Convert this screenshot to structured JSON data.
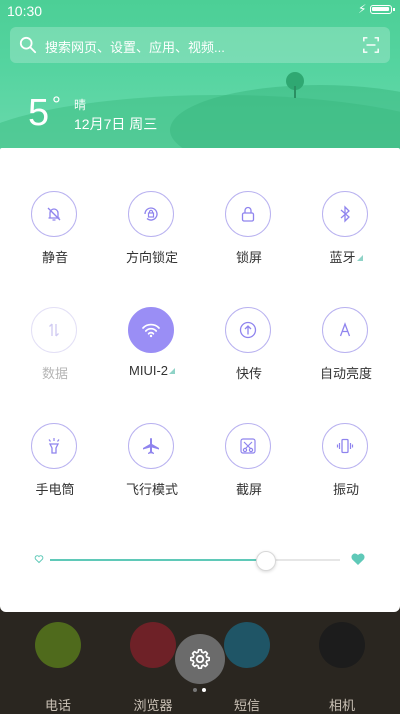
{
  "status": {
    "time": "10:30"
  },
  "search": {
    "placeholder": "搜索网页、设置、应用、视频..."
  },
  "weather": {
    "temp": "5",
    "degree": "°",
    "condition": "晴",
    "date": "12月7日 周三"
  },
  "tiles": [
    {
      "label": "静音",
      "icon": "mute-icon",
      "state": "normal"
    },
    {
      "label": "方向锁定",
      "icon": "rotation-lock-icon",
      "state": "normal"
    },
    {
      "label": "锁屏",
      "icon": "lock-icon",
      "state": "normal"
    },
    {
      "label": "蓝牙",
      "icon": "bluetooth-icon",
      "state": "normal",
      "expandable": true
    },
    {
      "label": "数据",
      "icon": "mobile-data-icon",
      "state": "disabled"
    },
    {
      "label": "MIUI-2",
      "icon": "wifi-icon",
      "state": "active",
      "expandable": true
    },
    {
      "label": "快传",
      "icon": "quick-share-icon",
      "state": "normal"
    },
    {
      "label": "自动亮度",
      "icon": "auto-brightness-icon",
      "state": "normal"
    },
    {
      "label": "手电筒",
      "icon": "flashlight-icon",
      "state": "normal"
    },
    {
      "label": "飞行模式",
      "icon": "airplane-icon",
      "state": "normal"
    },
    {
      "label": "截屏",
      "icon": "screenshot-icon",
      "state": "normal"
    },
    {
      "label": "振动",
      "icon": "vibrate-icon",
      "state": "normal"
    }
  ],
  "brightness": {
    "level": 0.74
  },
  "dock": [
    {
      "label": "电话",
      "icon": "phone-icon",
      "color": "#4f6a1c"
    },
    {
      "label": "浏览器",
      "icon": "browser-icon",
      "color": "#6e2127"
    },
    {
      "label": "短信",
      "icon": "messages-icon",
      "color": "#1f5566"
    },
    {
      "label": "相机",
      "icon": "camera-icon",
      "color": "#1c1c1c"
    }
  ],
  "colors": {
    "accent": "#9a8ef5",
    "header": "#55d4a0",
    "slider": "#5fc9b8"
  }
}
